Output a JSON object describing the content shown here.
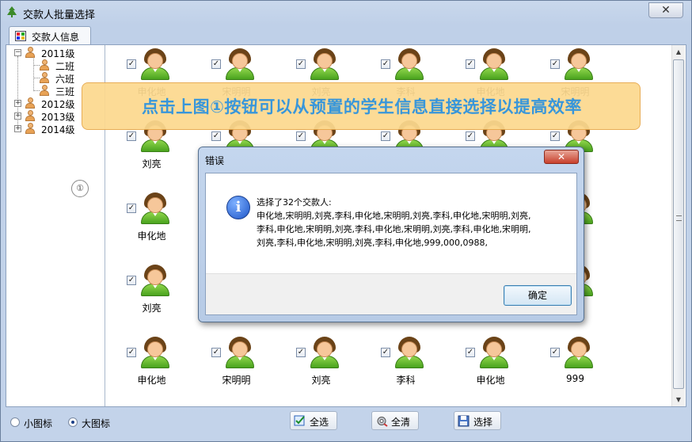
{
  "window": {
    "title": "交款人批量选择",
    "close_glyph": "✕"
  },
  "tab": {
    "label": "交款人信息"
  },
  "tree": {
    "nodes": [
      {
        "label": "2011级",
        "expander": "−"
      },
      {
        "label": "二班"
      },
      {
        "label": "六班"
      },
      {
        "label": "三班"
      },
      {
        "label": "2012级",
        "expander": "+"
      },
      {
        "label": "2013级",
        "expander": "+"
      },
      {
        "label": "2014级",
        "expander": "+"
      }
    ]
  },
  "grid": {
    "rows": [
      [
        "申化地",
        "宋明明",
        "刘亮",
        "李科",
        "申化地",
        "宋明明"
      ],
      [
        "刘亮",
        "",
        "",
        "",
        "",
        ""
      ],
      [
        "申化地",
        "",
        "",
        "",
        "",
        ""
      ],
      [
        "刘亮",
        "",
        "",
        "",
        "",
        ""
      ],
      [
        "申化地",
        "宋明明",
        "刘亮",
        "李科",
        "申化地",
        "999"
      ]
    ]
  },
  "banner": {
    "text": "点击上图①按钮可以从预置的学生信息直接选择以提高效率"
  },
  "side_marker": {
    "glyph": "①"
  },
  "dialog": {
    "title": "错误",
    "close_glyph": "✕",
    "icon_glyph": "i",
    "message_heading": "选择了32个交款人:",
    "message_lines": [
      "申化地,宋明明,刘亮,李科,申化地,宋明明,刘亮,李科,申化地,宋明明,刘亮,",
      "李科,申化地,宋明明,刘亮,李科,申化地,宋明明,刘亮,李科,申化地,宋明明,",
      "刘亮,李科,申化地,宋明明,刘亮,李科,申化地,999,000,0988,"
    ],
    "ok_label": "确定"
  },
  "footer": {
    "radio_small": "小图标",
    "radio_large": "大图标",
    "btn_select_all": "全选",
    "btn_clear_all": "全清",
    "btn_select": "选择"
  },
  "colors": {
    "banner_bg": "#fcd98f",
    "banner_text": "#2a8fd8",
    "avatar_shirt": "#6cc234"
  }
}
